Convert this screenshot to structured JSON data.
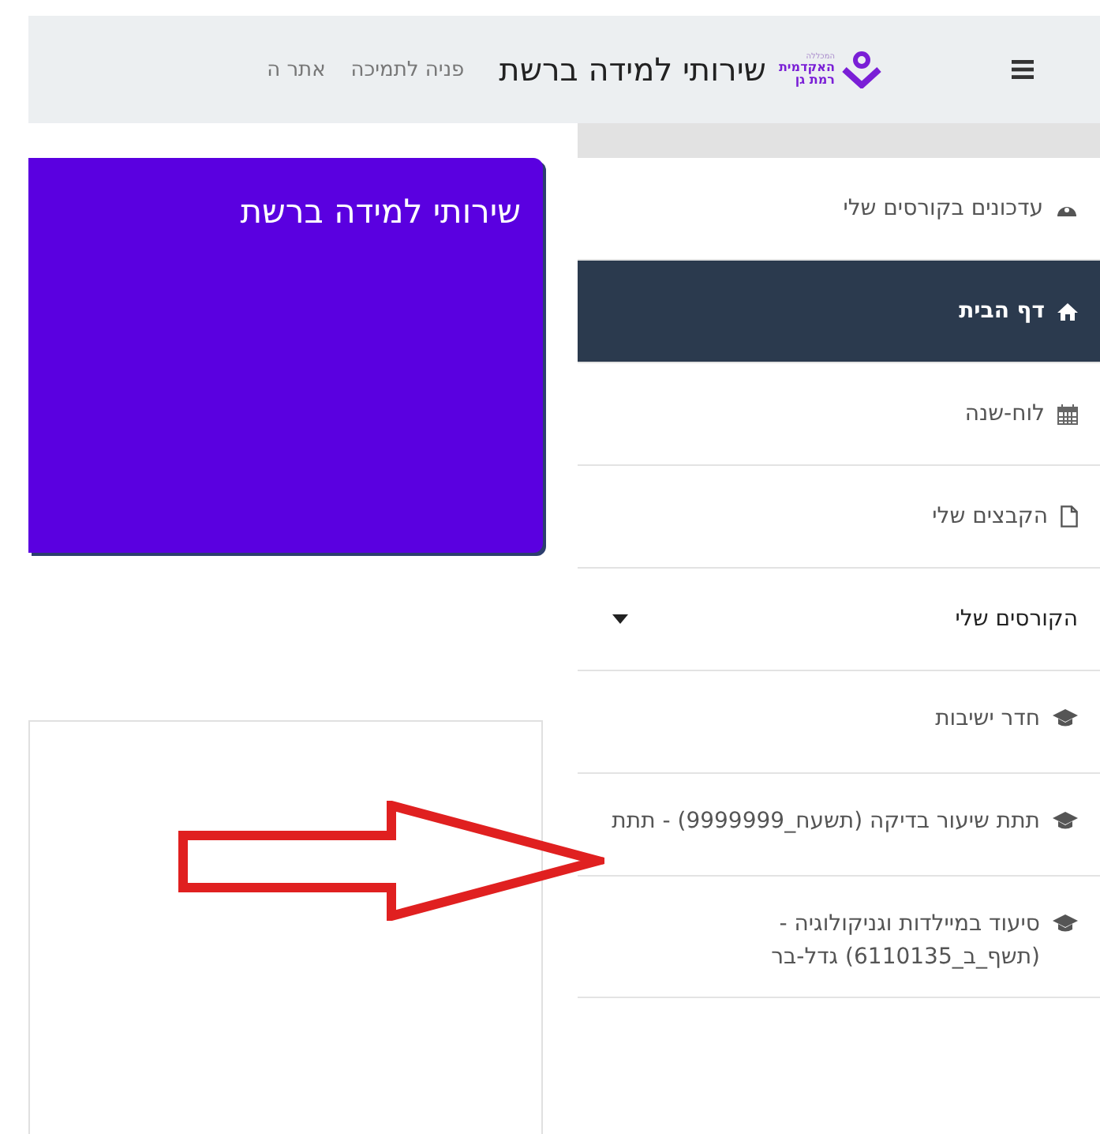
{
  "header": {
    "logo_lines": [
      "המכללה",
      "האקדמית",
      "רמת גן"
    ],
    "title": "שירותי למידה ברשת",
    "links": [
      "פניה לתמיכה",
      "אתר ה"
    ]
  },
  "banner": {
    "title": "שירותי למידה ברשת"
  },
  "sidebar": {
    "items": [
      {
        "kind": "dashboard",
        "label": "עדכונים בקורסים שלי",
        "selected": false
      },
      {
        "kind": "home",
        "label": "דף הבית",
        "selected": true
      },
      {
        "kind": "calendar",
        "label": "לוח-שנה",
        "selected": false
      },
      {
        "kind": "file",
        "label": "הקבצים שלי",
        "selected": false
      },
      {
        "kind": "section",
        "label": "הקורסים שלי",
        "selected": false
      },
      {
        "kind": "course",
        "label": "חדר ישיבות",
        "selected": false
      },
      {
        "kind": "course",
        "label": "תתת שיעור בדיקה (תשעח_9999999) - תתת",
        "selected": false
      },
      {
        "kind": "course",
        "label": "סיעוד במיילדות וגניקולוגיה - (תשף_ב_6110135) גדל-בר",
        "selected": false
      }
    ]
  }
}
